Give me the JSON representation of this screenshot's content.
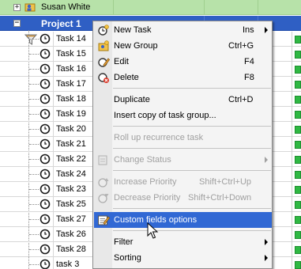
{
  "tree": {
    "user_row": {
      "name": "Susan White",
      "expander": "+"
    },
    "project_row": {
      "name": "Project 1",
      "expander": "−"
    },
    "tasks": [
      {
        "name": "Task 14"
      },
      {
        "name": "Task 15"
      },
      {
        "name": "Task 16"
      },
      {
        "name": "Task 17"
      },
      {
        "name": "Task 18"
      },
      {
        "name": "Task 19"
      },
      {
        "name": "Task 20"
      },
      {
        "name": "Task 21"
      },
      {
        "name": "Task 22"
      },
      {
        "name": "Task 24"
      },
      {
        "name": "Task 23"
      },
      {
        "name": "Task 25"
      },
      {
        "name": "Task 27"
      },
      {
        "name": "Task 26"
      },
      {
        "name": "Task 28"
      },
      {
        "name": "task 3"
      }
    ]
  },
  "context_menu": {
    "new_task": {
      "label": "New Task",
      "shortcut": "Ins"
    },
    "new_group": {
      "label": "New Group",
      "shortcut": "Ctrl+G"
    },
    "edit": {
      "label": "Edit",
      "shortcut": "F4"
    },
    "delete": {
      "label": "Delete",
      "shortcut": "F8"
    },
    "duplicate": {
      "label": "Duplicate",
      "shortcut": "Ctrl+D"
    },
    "insert_copy": {
      "label": "Insert copy of task group..."
    },
    "roll_up": {
      "label": "Roll up recurrence task"
    },
    "change_status": {
      "label": "Change Status"
    },
    "increase_priority": {
      "label": "Increase Priority",
      "shortcut": "Shift+Ctrl+Up"
    },
    "decrease_priority": {
      "label": "Decrease Priority",
      "shortcut": "Shift+Ctrl+Down"
    },
    "custom_fields": {
      "label": "Custom fields options"
    },
    "filter": {
      "label": "Filter"
    },
    "sorting": {
      "label": "Sorting"
    }
  },
  "colors": {
    "user_row_bg": "#b7e2a9",
    "project_row_bg": "#2f5fc4",
    "menu_highlight": "#3168d4",
    "status_green": "#2fb843"
  },
  "icons": {
    "user": "user-group-icon",
    "project": "funnel-icon",
    "task": "clock-icon"
  }
}
